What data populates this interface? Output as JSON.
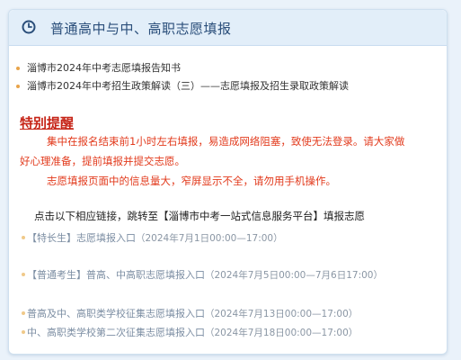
{
  "header": {
    "title": "普通高中与中、高职志愿填报",
    "icon": "clock-icon"
  },
  "notices": [
    "淄博市2024年中考志愿填报告知书",
    "淄博市2024年中考招生政策解读（三）——志愿填报及招生录取政策解读"
  ],
  "alert": {
    "title": "特别提醒",
    "line1": "集中在报名结束前1小时左右填报，易造成网络阻塞，致使无法登录。请大家做",
    "line2": "好心理准备，提前填报并提交志愿。",
    "line3": "志愿填报页面中的信息量大，窄屏显示不全，请勿用手机操作。"
  },
  "intro": "点击以下相应链接，跳转至【淄博市中考一站式信息服务平台】填报志愿",
  "links": [
    {
      "label": "【特长生】志愿填报入口",
      "time": "（2024年7月1日00:00—17:00）"
    },
    {
      "label": "【普通考生】普高、中高职志愿填报入口",
      "time": "（2024年7月5日00:00—7月6日17:00）"
    },
    {
      "label": "普高及中、高职类学校征集志愿填报入口",
      "time": "（2024年7月13日00:00—17:00）"
    },
    {
      "label": "中、高职类学校第二次征集志愿填报入口",
      "time": "（2024年7月18日00:00—17:00）"
    }
  ],
  "colors": {
    "accent": "#2a4e7a",
    "alert": "#e23a1c",
    "bullet": "#e8a44a",
    "link": "#7c8ea3"
  }
}
